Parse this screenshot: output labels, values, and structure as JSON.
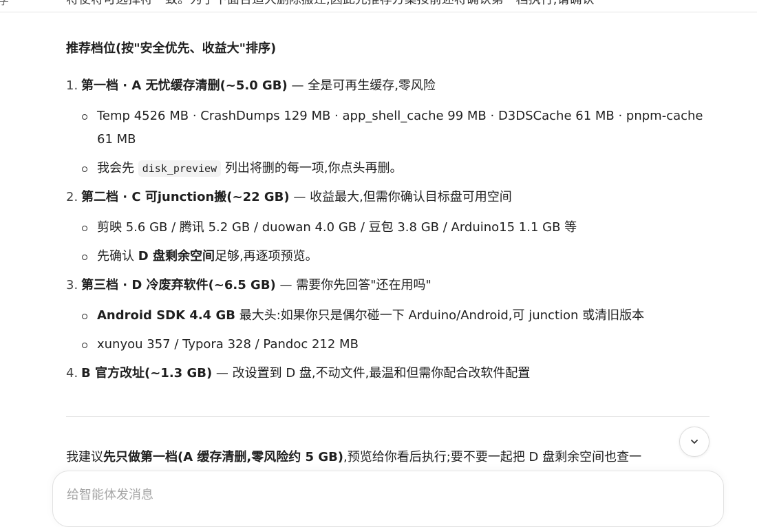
{
  "top_fragment": "字",
  "clipped_intro": "将使将可选择符一致。为了下面合适大删除搬迁,因此先推荐方案按前述将确认第一档执行,请确认",
  "heading": "推荐档位(按\"安全优先、收益大\"排序)",
  "levels": [
    {
      "num": "1.",
      "title": "第一档 · A 无忧缓存清删(~5.0 GB)",
      "note": " — 全是可再生缓存,零风险",
      "items": [
        {
          "text": "Temp 4526 MB · CrashDumps 129 MB · app_shell_cache 99 MB · D3DSCache 61 MB · pnpm-cache 61 MB"
        },
        {
          "pre": "我会先 ",
          "code": "disk_preview",
          "post": " 列出将删的每一项,你点头再删。"
        }
      ]
    },
    {
      "num": "2.",
      "title": "第二档 · C 可junction搬(~22 GB)",
      "note": " — 收益最大,但需你确认目标盘可用空间",
      "items": [
        {
          "text": "剪映 5.6 GB / 腾讯 5.2 GB / duowan 4.0 GB / 豆包 3.8 GB / Arduino15 1.1 GB 等"
        },
        {
          "pre": "先确认 ",
          "bold": "D 盘剩余空间",
          "post": "足够,再逐项预览。"
        }
      ]
    },
    {
      "num": "3.",
      "title": "第三档 · D 冷废弃软件(~6.5 GB)",
      "note": " — 需要你先回答\"还在用吗\"",
      "items": [
        {
          "bold": "Android SDK 4.4 GB",
          "post": " 最大头:如果你只是偶尔碰一下 Arduino/Android,可 junction 或清旧版本"
        },
        {
          "text": "xunyou 357 / Typora 328 / Pandoc 212 MB"
        }
      ]
    },
    {
      "num": "4.",
      "title": "B 官方改址(~1.3 GB)",
      "note": " — 改设置到 D 盘,不动文件,最温和但需你配合改软件配置",
      "items": []
    }
  ],
  "final": {
    "pre": "我建议",
    "bold": "先只做第一档(A 缓存清删,零风险约 5 GB)",
    "post": ",预览给你看后执行;要不要一起把 D 盘剩余空间也查一"
  },
  "composer": {
    "placeholder": "给智能体发消息"
  }
}
